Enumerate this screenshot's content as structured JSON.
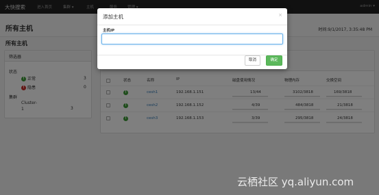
{
  "topbar": {
    "brand": "大快搜索",
    "nav": [
      "进入首页",
      "集群 ▾",
      "主机",
      "服务",
      "管理 ▾"
    ],
    "user": "admin ▾"
  },
  "header": {
    "title": "所有主机",
    "clock": "时间:9/1/2017, 3:35:48 PM"
  },
  "section_title": "所有主机",
  "filters": {
    "title": "筛选器",
    "status_label": "状态",
    "normal_label": "正常",
    "normal_count": "3",
    "hidden_label": "隐患",
    "hidden_count": "0",
    "cluster_label": "集群",
    "cluster_name": "Cluster-1",
    "cluster_count": "3"
  },
  "table": {
    "headers": [
      "状态",
      "名称",
      "IP",
      "磁盘使用情况",
      "物理内存",
      "交换空间"
    ],
    "rows": [
      {
        "name": "cesh1",
        "ip": "192.168.1.151",
        "disk": "13/44",
        "disk_frac": 0.3,
        "mem": "3102/3818",
        "mem_frac": 0.81,
        "swap": "169/3818",
        "swap_frac": 0.04
      },
      {
        "name": "cesh2",
        "ip": "192.168.1.152",
        "disk": "4/39",
        "disk_frac": 0.1,
        "mem": "484/3818",
        "mem_frac": 0.13,
        "swap": "21/3818",
        "swap_frac": 0.01
      },
      {
        "name": "cesh3",
        "ip": "192.168.1.153",
        "disk": "3/39",
        "disk_frac": 0.08,
        "mem": "295/3818",
        "mem_frac": 0.08,
        "swap": "24/3818",
        "swap_frac": 0.01
      }
    ]
  },
  "modal": {
    "title": "添加主机",
    "close": "×",
    "field_label": "主机IP",
    "field_value": "",
    "cancel": "取消",
    "confirm": "确定"
  },
  "watermark": "云栖社区 yq.aliyun.com"
}
